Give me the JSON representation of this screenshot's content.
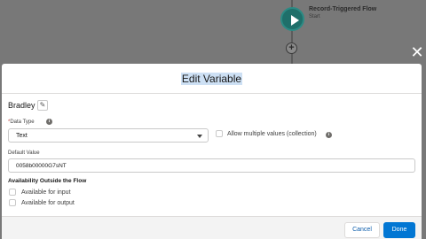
{
  "canvas": {
    "start_node": {
      "title": "Record-Triggered Flow",
      "subtitle": "Start"
    },
    "add_node_symbol": "+",
    "close_symbol": "✕"
  },
  "modal": {
    "title": "Edit Variable",
    "variable_name": "Bradley",
    "edit_icon": "pencil-icon",
    "data_type": {
      "required_mark": "*",
      "label": "Data Type",
      "selected": "Text"
    },
    "allow_multiple": {
      "label": "Allow multiple values (collection)",
      "checked": false
    },
    "default_value": {
      "label": "Default Value",
      "value": "0058b00000G7sNT"
    },
    "availability": {
      "label": "Availability Outside the Flow",
      "options": [
        {
          "label": "Available for input",
          "checked": false
        },
        {
          "label": "Available for output",
          "checked": false
        }
      ]
    },
    "footer": {
      "cancel_label": "Cancel",
      "done_label": "Done"
    }
  },
  "colors": {
    "brand_blue": "#0176d3",
    "start_node": "#1f6f6a",
    "required": "#c23934"
  }
}
